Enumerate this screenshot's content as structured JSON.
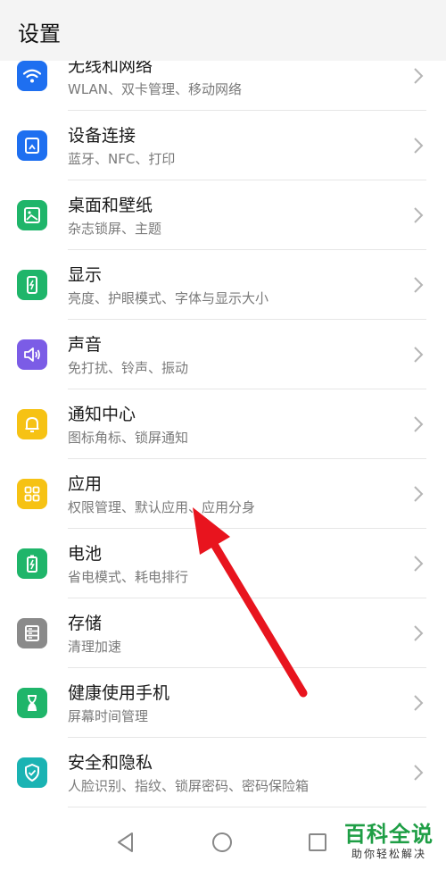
{
  "header": {
    "title": "设置"
  },
  "items": [
    {
      "title": "无线和网络",
      "subtitle": "WLAN、双卡管理、移动网络",
      "icon": "wifi-icon",
      "color": "#1e6ff0"
    },
    {
      "title": "设备连接",
      "subtitle": "蓝牙、NFC、打印",
      "icon": "device-connection-icon",
      "color": "#1e6ff0"
    },
    {
      "title": "桌面和壁纸",
      "subtitle": "杂志锁屏、主题",
      "icon": "wallpaper-icon",
      "color": "#1fb56a"
    },
    {
      "title": "显示",
      "subtitle": "亮度、护眼模式、字体与显示大小",
      "icon": "display-icon",
      "color": "#1fb56a"
    },
    {
      "title": "声音",
      "subtitle": "免打扰、铃声、振动",
      "icon": "speaker-icon",
      "color": "#7b5ce6"
    },
    {
      "title": "通知中心",
      "subtitle": "图标角标、锁屏通知",
      "icon": "bell-icon",
      "color": "#f6c214"
    },
    {
      "title": "应用",
      "subtitle": "权限管理、默认应用、应用分身",
      "icon": "apps-grid-icon",
      "color": "#f6c214"
    },
    {
      "title": "电池",
      "subtitle": "省电模式、耗电排行",
      "icon": "battery-icon",
      "color": "#1fb56a"
    },
    {
      "title": "存储",
      "subtitle": "清理加速",
      "icon": "storage-icon",
      "color": "#8a8a8a"
    },
    {
      "title": "健康使用手机",
      "subtitle": "屏幕时间管理",
      "icon": "hourglass-icon",
      "color": "#1fb56a"
    },
    {
      "title": "安全和隐私",
      "subtitle": "人脸识别、指纹、锁屏密码、密码保险箱",
      "icon": "shield-icon",
      "color": "#1ab3b3"
    }
  ],
  "watermark": {
    "line1": "百科全说",
    "line2": "助你轻松解决"
  },
  "annotation": {
    "arrow_color": "#e8141e"
  }
}
